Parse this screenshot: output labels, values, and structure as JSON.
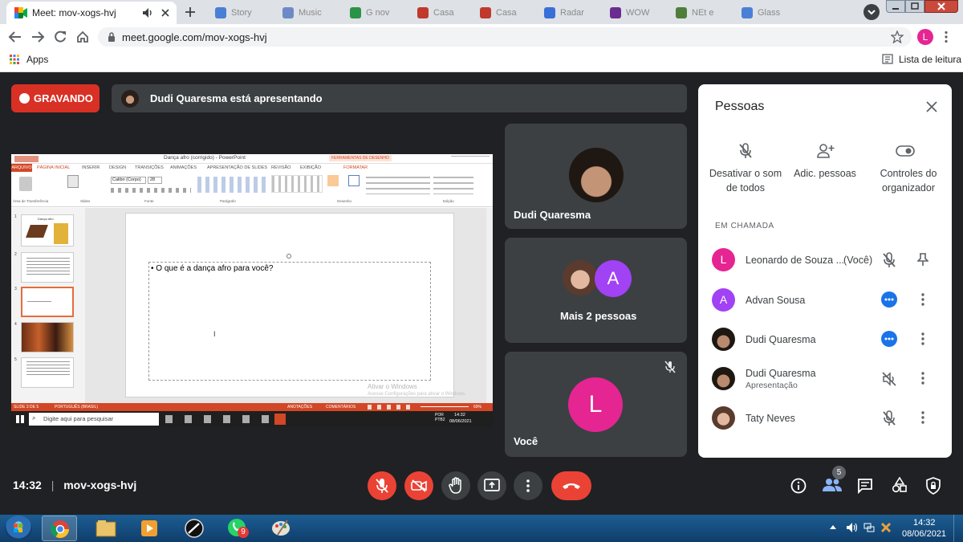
{
  "browser": {
    "active_tab_title": "Meet: mov-xogs-hvj",
    "url": "meet.google.com/mov-xogs-hvj",
    "bookmarks_apps": "Apps",
    "reading_list": "Lista de leitura",
    "profile_initial": "L",
    "background_tabs": [
      "Story",
      "Music",
      "G nov",
      "Casa",
      "Casa",
      "Radar",
      "WOW",
      "NEt e",
      "Glass"
    ],
    "colors": {
      "accent": "#1a73e8",
      "profile": "#e52592"
    }
  },
  "meet": {
    "recording_label": "GRAVANDO",
    "presenting_text": "Dudi Quaresma está apresentando",
    "meeting_time": "14:32",
    "meeting_code": "mov-xogs-hvj",
    "participants_badge": "5",
    "tiles": {
      "dudi": {
        "name": "Dudi Quaresma"
      },
      "more": {
        "label": "Mais 2 pessoas",
        "avatar_initial": "A"
      },
      "you": {
        "name": "Você",
        "avatar_initial": "L"
      }
    },
    "panel": {
      "title": "Pessoas",
      "actions": [
        {
          "label": "Desativar o som de todos",
          "icon": "mic-off-icon"
        },
        {
          "label": "Adic. pessoas",
          "icon": "person-add-icon"
        },
        {
          "label": "Controles do organizador",
          "icon": "toggle-icon"
        }
      ],
      "section_label": "EM CHAMADA",
      "people": [
        {
          "name": "Leonardo de Souza ...",
          "suffix": "(Você)",
          "initial": "L",
          "color": "#e52592",
          "status": "mic-off"
        },
        {
          "name": "Advan Sousa",
          "initial": "A",
          "color": "#a142f4",
          "status": "speaking"
        },
        {
          "name": "Dudi Quaresma",
          "initial": "",
          "color": "#5f4b3a",
          "status": "speaking"
        },
        {
          "name": "Dudi Quaresma",
          "sub": "Apresentação",
          "initial": "",
          "color": "#5f4b3a",
          "status": "volume-off"
        },
        {
          "name": "Taty Neves",
          "initial": "",
          "color": "#c9a28a",
          "status": "mic-off"
        }
      ]
    },
    "colors": {
      "record_red": "#d93025",
      "end_call_red": "#ea4335",
      "tile_bg": "#3c4043"
    }
  },
  "presentation": {
    "window_title": "Dança afro (corrigido) - PowerPoint",
    "context_tab": "FERRAMENTAS DE DESENHO",
    "ribbon_tabs": [
      "ARQUIVO",
      "PÁGINA INICIAL",
      "INSERIR",
      "DESIGN",
      "TRANSIÇÕES",
      "ANIMAÇÕES",
      "APRESENTAÇÃO DE SLIDES",
      "REVISÃO",
      "EXIBIÇÃO",
      "FORMATAR"
    ],
    "ribbon_groups": [
      "Área de Transferência",
      "Slides",
      "Fonte",
      "Parágrafo",
      "Desenho",
      "Edição"
    ],
    "font_name": "Calibri (Corpo)",
    "font_size": "28",
    "slide_thumb_title": "Dança afro",
    "slide_numbers": [
      "1",
      "2",
      "3",
      "4",
      "5"
    ],
    "slide_bullet": "O que é a dança afro para você?",
    "watermark_line1": "Ativar o Windows",
    "watermark_line2": "Acesse Configurações para ativar o Windows.",
    "status_slide": "SLIDE 3 DE 5",
    "status_language": "PORTUGUÊS (BRASIL)",
    "status_notes": "ANOTAÇÕES",
    "status_comments": "COMENTÁRIOS",
    "zoom": "69%",
    "inner_search_placeholder": "Digite aqui para pesquisar",
    "inner_time": "14:32",
    "inner_date": "08/06/2021",
    "inner_lang": "POR PTB2"
  },
  "taskbar": {
    "time": "14:32",
    "date": "08/06/2021",
    "whatsapp_badge": "9"
  }
}
